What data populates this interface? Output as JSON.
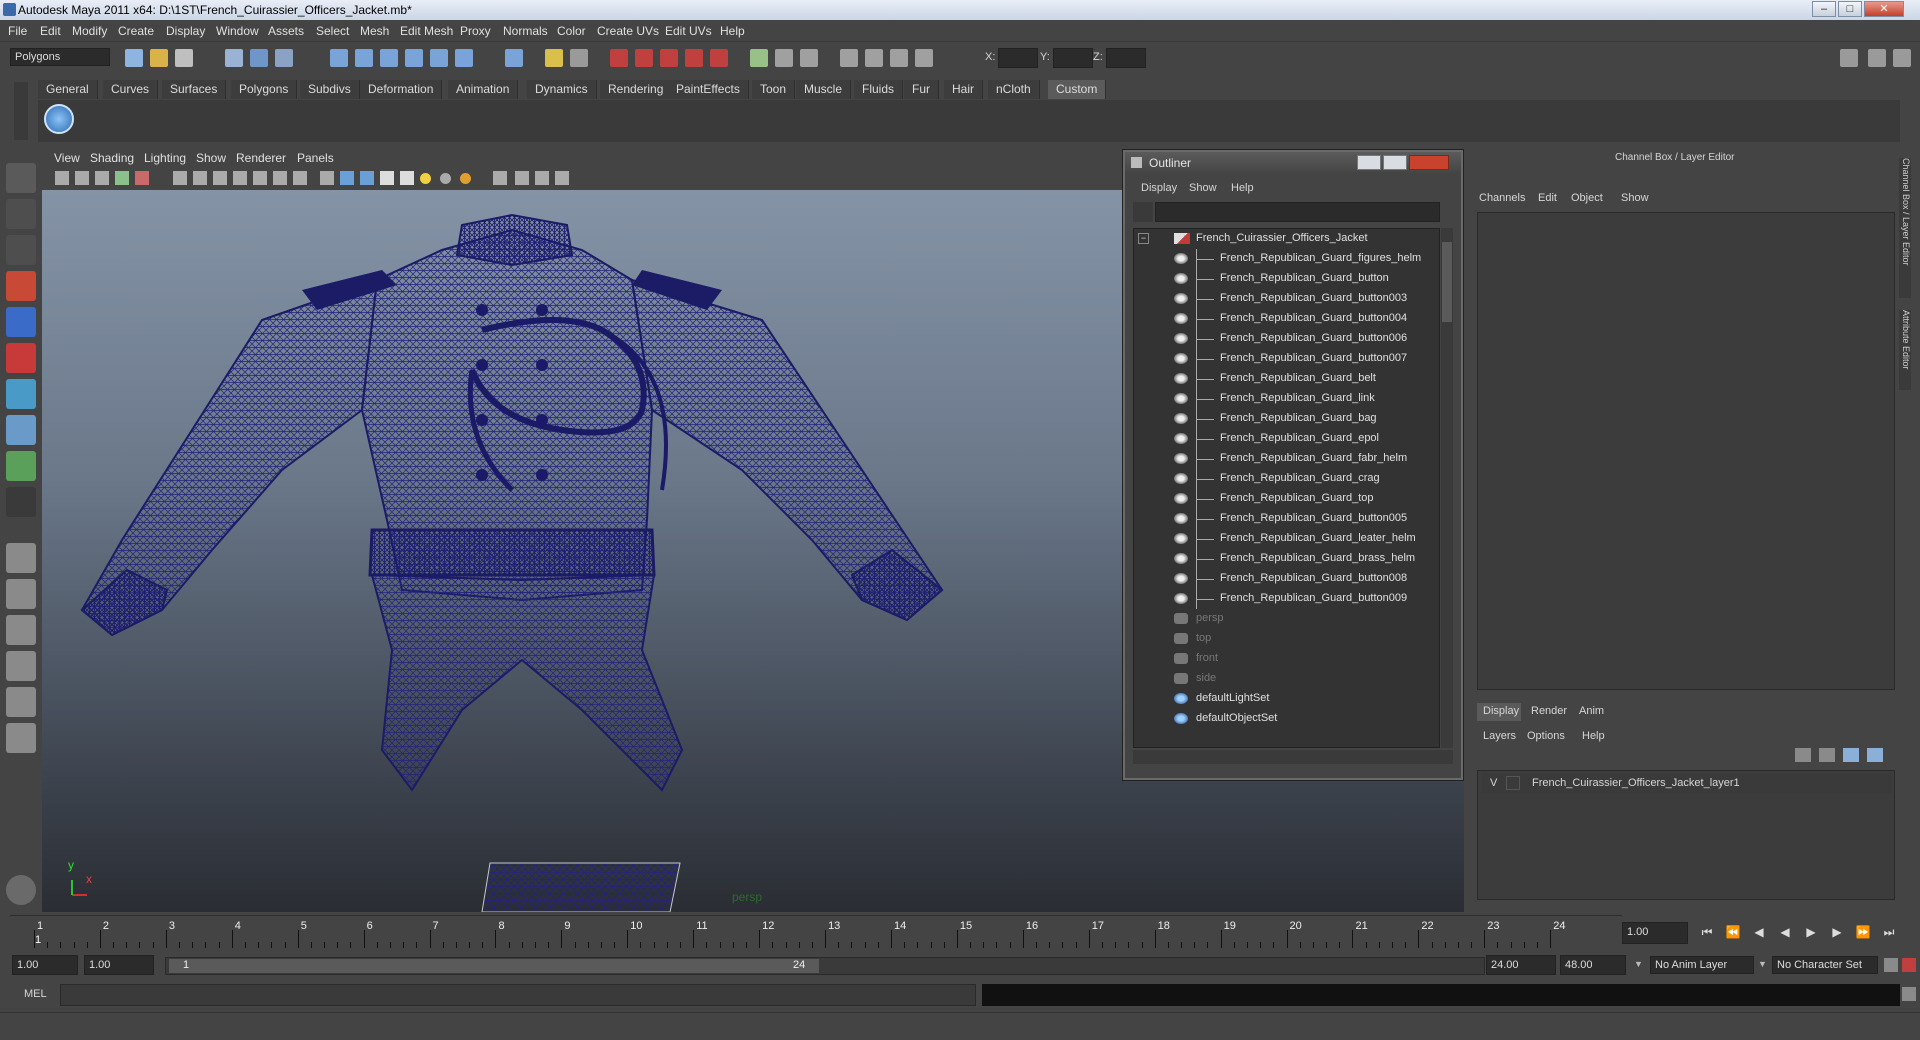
{
  "window": {
    "title": "Autodesk Maya 2011 x64: D:\\1ST\\French_Cuirassier_Officers_Jacket.mb*",
    "buttons": [
      "–",
      "□",
      "✕"
    ]
  },
  "menubar": [
    "File",
    "Edit",
    "Modify",
    "Create",
    "Display",
    "Window",
    "Assets",
    "Select",
    "Mesh",
    "Edit Mesh",
    "Proxy",
    "Normals",
    "Color",
    "Create UVs",
    "Edit UVs",
    "Help"
  ],
  "toolbar": {
    "mode_select": "Polygons",
    "x_label": "X:",
    "y_label": "Y:",
    "z_label": "Z:"
  },
  "shelf": {
    "tabs": [
      "General",
      "Curves",
      "Surfaces",
      "Polygons",
      "Subdivs",
      "Deformation",
      "Animation",
      "Dynamics",
      "Rendering",
      "PaintEffects",
      "Toon",
      "Muscle",
      "Fluids",
      "Fur",
      "Hair",
      "nCloth",
      "Custom"
    ],
    "active_tab": "Custom"
  },
  "viewport": {
    "menu": [
      "View",
      "Shading",
      "Lighting",
      "Show",
      "Renderer",
      "Panels"
    ],
    "camera_label": "persp",
    "axis_x": "x",
    "axis_y": "y"
  },
  "outliner": {
    "title": "Outliner",
    "menu": [
      "Display",
      "Show",
      "Help"
    ],
    "root": "French_Cuirassier_Officers_Jacket",
    "children": [
      "French_Republican_Guard_figures_helm",
      "French_Republican_Guard_button",
      "French_Republican_Guard_button003",
      "French_Republican_Guard_button004",
      "French_Republican_Guard_button006",
      "French_Republican_Guard_button007",
      "French_Republican_Guard_belt",
      "French_Republican_Guard_link",
      "French_Republican_Guard_bag",
      "French_Republican_Guard_epol",
      "French_Republican_Guard_fabr_helm",
      "French_Republican_Guard_crag",
      "French_Republican_Guard_top",
      "French_Republican_Guard_button005",
      "French_Republican_Guard_leater_helm",
      "French_Republican_Guard_brass_helm",
      "French_Republican_Guard_button008",
      "French_Republican_Guard_button009"
    ],
    "cameras": [
      "persp",
      "top",
      "front",
      "side"
    ],
    "sets": [
      "defaultLightSet",
      "defaultObjectSet"
    ]
  },
  "channelbox": {
    "title": "Channel Box / Layer Editor",
    "menu": [
      "Channels",
      "Edit",
      "Object",
      "Show"
    ],
    "side_tabs": [
      "Channel Box / Layer Editor",
      "Attribute Editor"
    ]
  },
  "layereditor": {
    "tabs": [
      "Display",
      "Render",
      "Anim"
    ],
    "active_tab": "Display",
    "menu": [
      "Layers",
      "Options",
      "Help"
    ],
    "layer": {
      "visible": "V",
      "name": "French_Cuirassier_Officers_Jacket_layer1"
    }
  },
  "timeline": {
    "ticks": [
      "1",
      "2",
      "3",
      "4",
      "5",
      "6",
      "7",
      "8",
      "9",
      "10",
      "11",
      "12",
      "13",
      "14",
      "15",
      "16",
      "17",
      "18",
      "19",
      "20",
      "21",
      "22",
      "23",
      "24"
    ],
    "current_frame_marker": "1",
    "current_time": "1.00"
  },
  "range": {
    "start_time": "1.00",
    "playback_start": "1.00",
    "range_start_label": "1",
    "range_end_label": "24",
    "playback_end": "24.00",
    "end_time": "48.00",
    "anim_layer": "No Anim Layer",
    "character_set": "No Character Set"
  },
  "cmdline": {
    "label": "MEL"
  }
}
